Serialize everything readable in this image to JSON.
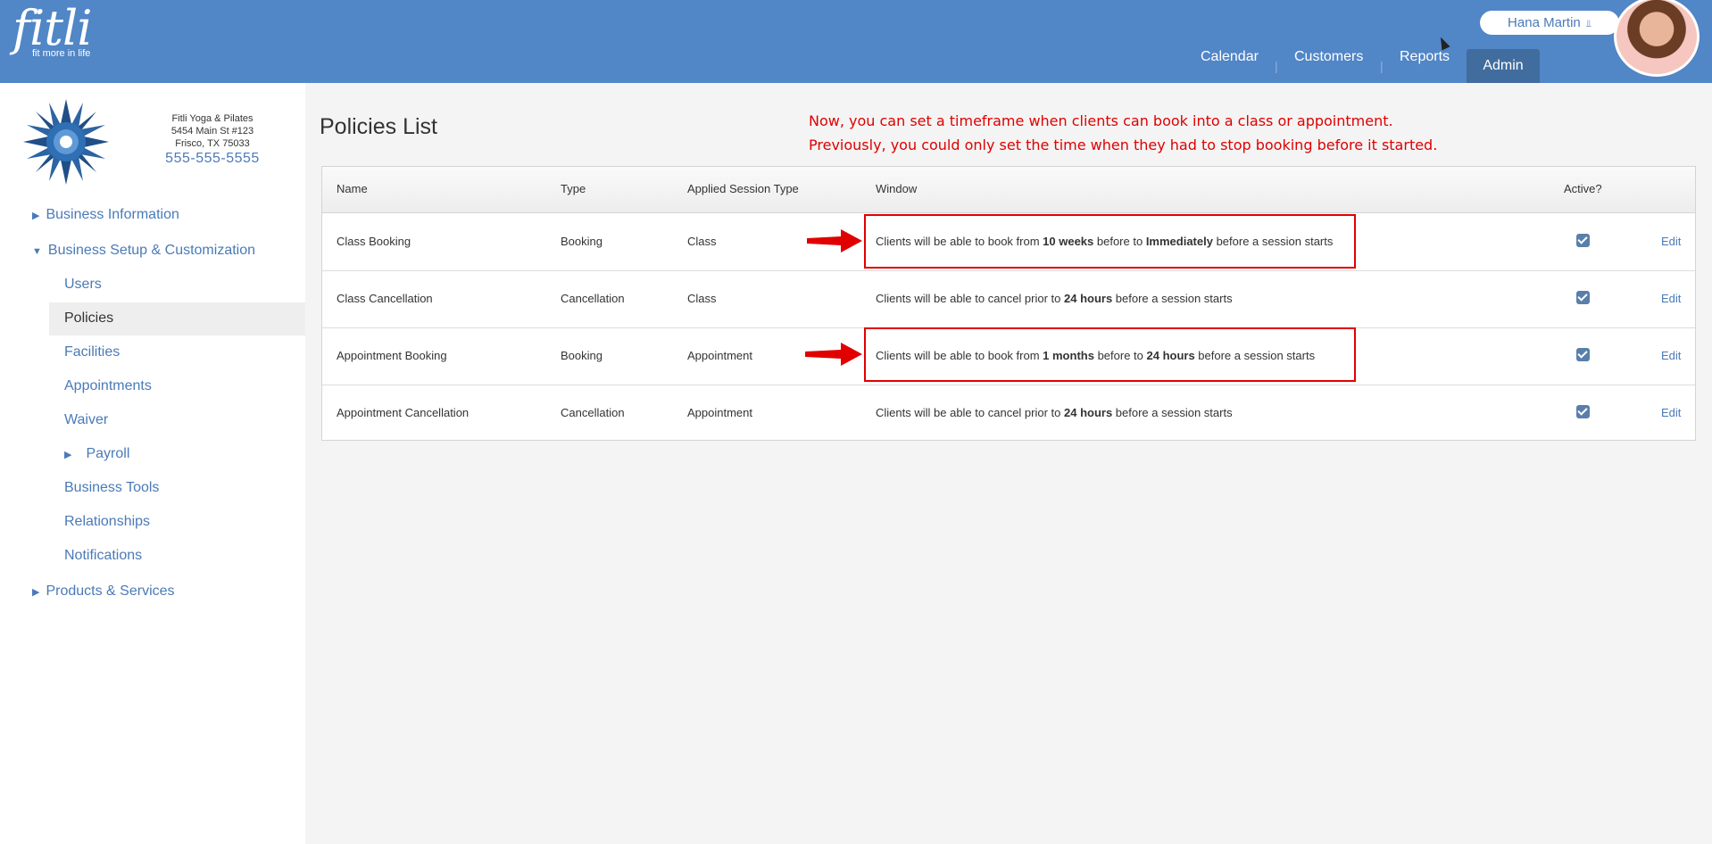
{
  "header": {
    "logo_text": "fitli",
    "logo_tagline": "fit more in life",
    "user_name": "Hana Martin",
    "nav": [
      {
        "label": "Calendar"
      },
      {
        "label": "Customers"
      },
      {
        "label": "Reports"
      },
      {
        "label": "Admin"
      }
    ],
    "nav_separator": "|"
  },
  "business": {
    "name": "Fitli Yoga & Pilates",
    "address1": "5454 Main St #123",
    "address2": "Frisco, TX 75033",
    "phone": "555-555-5555"
  },
  "sidebar": {
    "items": [
      {
        "label": "Business Information",
        "caret": "▶"
      },
      {
        "label": "Business Setup & Customization",
        "caret": "▼"
      },
      {
        "label": "Users"
      },
      {
        "label": "Policies"
      },
      {
        "label": "Facilities"
      },
      {
        "label": "Appointments"
      },
      {
        "label": "Waiver"
      },
      {
        "label": "Payroll",
        "caret": "▶"
      },
      {
        "label": "Business Tools"
      },
      {
        "label": "Relationships"
      },
      {
        "label": "Notifications"
      },
      {
        "label": "Products & Services",
        "caret": "▶"
      }
    ]
  },
  "main": {
    "title": "Policies List",
    "notice_line1": "Now, you can set a timeframe when clients can book into a class or appointment.",
    "notice_line2": "Previously, you could only set the time when they had to stop booking before it started.",
    "columns": {
      "name": "Name",
      "type": "Type",
      "session": "Applied Session Type",
      "window": "Window",
      "active": "Active?"
    },
    "rows": [
      {
        "name": "Class Booking",
        "type": "Booking",
        "session": "Class",
        "w_pre": "Clients will be able to book from ",
        "w_b1": "10 weeks",
        "w_mid": " before to ",
        "w_b2": "Immediately",
        "w_post": " before a session starts",
        "active": true,
        "edit": "Edit"
      },
      {
        "name": "Class Cancellation",
        "type": "Cancellation",
        "session": "Class",
        "w_pre": "Clients will be able to cancel prior to ",
        "w_b1": "24 hours",
        "w_mid": "",
        "w_b2": "",
        "w_post": " before a session starts",
        "active": true,
        "edit": "Edit"
      },
      {
        "name": "Appointment Booking",
        "type": "Booking",
        "session": "Appointment",
        "w_pre": "Clients will be able to book from ",
        "w_b1": "1 months",
        "w_mid": " before to ",
        "w_b2": "24 hours",
        "w_post": " before a session starts",
        "active": true,
        "edit": "Edit"
      },
      {
        "name": "Appointment Cancellation",
        "type": "Cancellation",
        "session": "Appointment",
        "w_pre": "Clients will be able to cancel prior to ",
        "w_b1": "24 hours",
        "w_mid": "",
        "w_b2": "",
        "w_post": " before a session starts",
        "active": true,
        "edit": "Edit"
      }
    ]
  },
  "colors": {
    "header_bg": "#5186c7",
    "nav_active_bg": "#416c9e",
    "link": "#4a7ab8",
    "annotation_red": "#e00000"
  }
}
